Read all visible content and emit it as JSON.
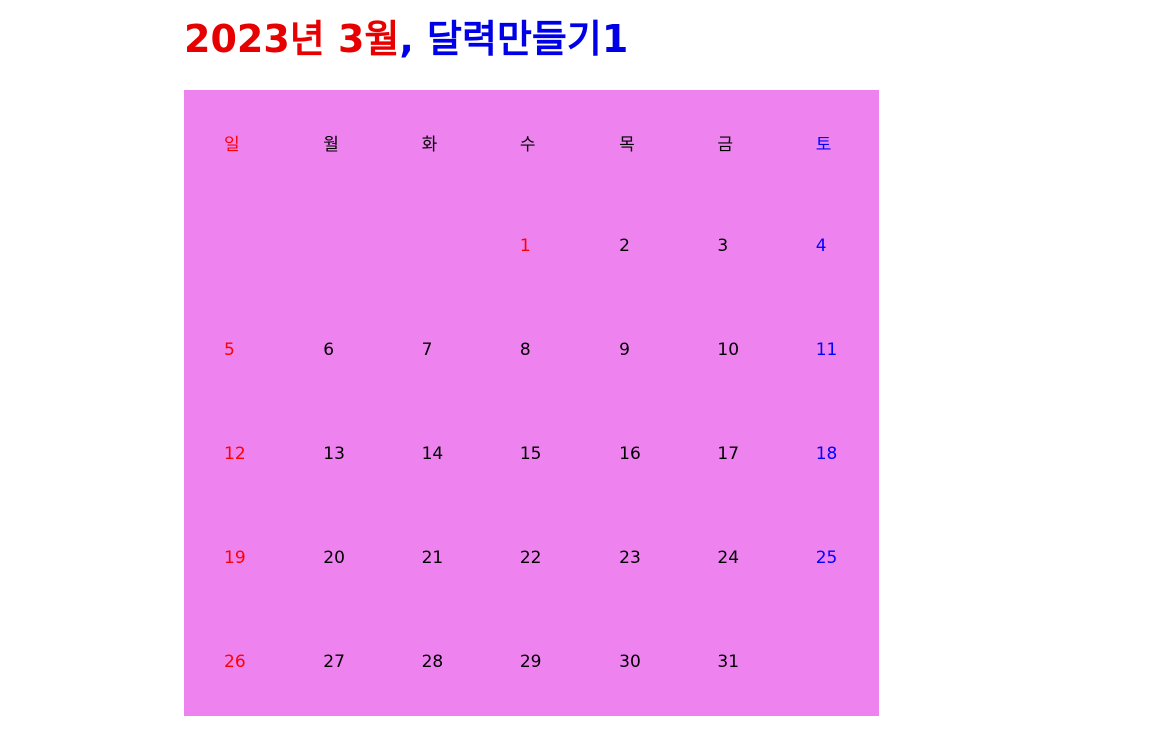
{
  "title": {
    "date": "2023년 3월",
    "separator": ",",
    "subtitle": "달력만들기1"
  },
  "colors": {
    "calendar_background": "#ee82ee",
    "sunday": "#ff0000",
    "saturday": "#0000ff",
    "weekday": "#000000",
    "title_date": "#e60000",
    "title_subtitle": "#0000e6"
  },
  "calendar": {
    "weekday_headers": [
      "일",
      "월",
      "화",
      "수",
      "목",
      "금",
      "토"
    ],
    "weeks": [
      [
        "",
        "",
        "",
        "1",
        "2",
        "3",
        "4"
      ],
      [
        "5",
        "6",
        "7",
        "8",
        "9",
        "10",
        "11"
      ],
      [
        "12",
        "13",
        "14",
        "15",
        "16",
        "17",
        "18"
      ],
      [
        "19",
        "20",
        "21",
        "22",
        "23",
        "24",
        "25"
      ],
      [
        "26",
        "27",
        "28",
        "29",
        "30",
        "31",
        ""
      ]
    ]
  }
}
